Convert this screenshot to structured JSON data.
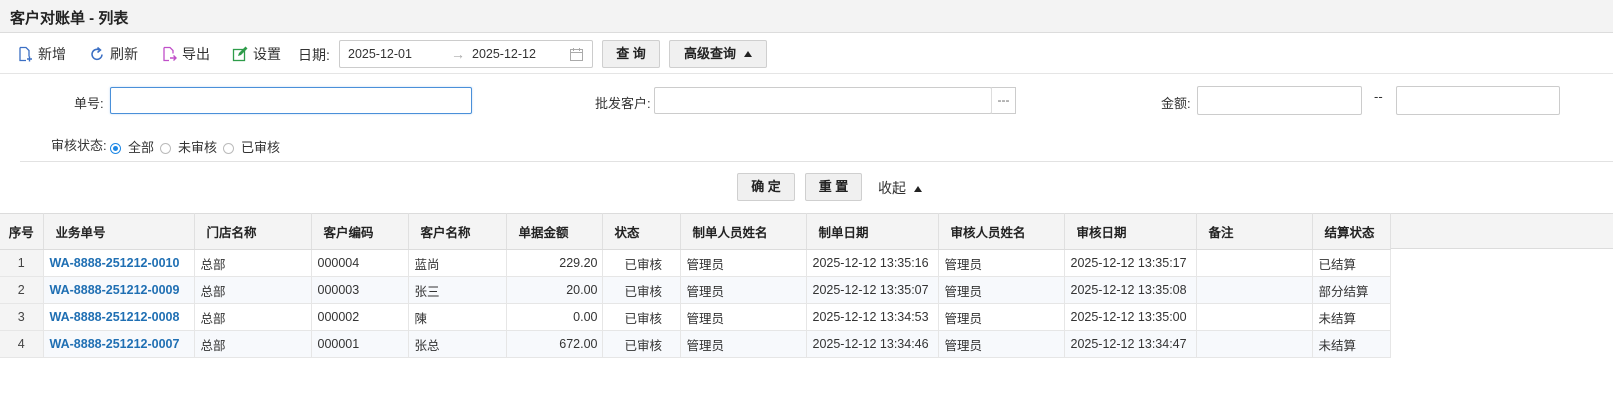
{
  "title": "客户对账单 - 列表",
  "toolbar": {
    "add": "新增",
    "refresh": "刷新",
    "export": "导出",
    "settings": "设置",
    "date_label": "日期:",
    "date_from": "2025-12-01",
    "date_to": "2025-12-12",
    "date_sep": "→",
    "query": "查 询",
    "advanced": "高级查询"
  },
  "filters": {
    "order_label": "单号:",
    "order_value": "",
    "customer_label": "批发客户:",
    "customer_value": "",
    "customer_btn": "---",
    "amount_label": "金额:",
    "amount_sep": "--",
    "amount_from": "",
    "amount_to": "",
    "audit_label": "审核状态:",
    "audit_options": [
      "全部",
      "未审核",
      "已审核"
    ],
    "audit_selected": "全部",
    "confirm": "确 定",
    "reset": "重 置",
    "collapse": "收起"
  },
  "table": {
    "columns": [
      "序号",
      "业务单号",
      "门店名称",
      "客户编码",
      "客户名称",
      "单据金额",
      "状态",
      "制单人员姓名",
      "制单日期",
      "审核人员姓名",
      "审核日期",
      "备注",
      "结算状态"
    ],
    "rows": [
      {
        "idx": "1",
        "no": "WA-8888-251212-0010",
        "store": "总部",
        "code": "000004",
        "name": "蓝尚",
        "amount": "229.20",
        "status": "已审核",
        "maker": "管理员",
        "made": "2025-12-12 13:35:16",
        "auditor": "管理员",
        "audited": "2025-12-12 13:35:17",
        "note": "",
        "settle": "已结算"
      },
      {
        "idx": "2",
        "no": "WA-8888-251212-0009",
        "store": "总部",
        "code": "000003",
        "name": "张三",
        "amount": "20.00",
        "status": "已审核",
        "maker": "管理员",
        "made": "2025-12-12 13:35:07",
        "auditor": "管理员",
        "audited": "2025-12-12 13:35:08",
        "note": "",
        "settle": "部分结算"
      },
      {
        "idx": "3",
        "no": "WA-8888-251212-0008",
        "store": "总部",
        "code": "000002",
        "name": "陳",
        "amount": "0.00",
        "status": "已审核",
        "maker": "管理员",
        "made": "2025-12-12 13:34:53",
        "auditor": "管理员",
        "audited": "2025-12-12 13:35:00",
        "note": "",
        "settle": "未结算"
      },
      {
        "idx": "4",
        "no": "WA-8888-251212-0007",
        "store": "总部",
        "code": "000001",
        "name": "张总",
        "amount": "672.00",
        "status": "已审核",
        "maker": "管理员",
        "made": "2025-12-12 13:34:46",
        "auditor": "管理员",
        "audited": "2025-12-12 13:34:47",
        "note": "",
        "settle": "未结算"
      }
    ]
  },
  "colors": {
    "accent": "#1e88e5",
    "link": "#1f6fb3",
    "header_bg": "#f4f4f4"
  }
}
